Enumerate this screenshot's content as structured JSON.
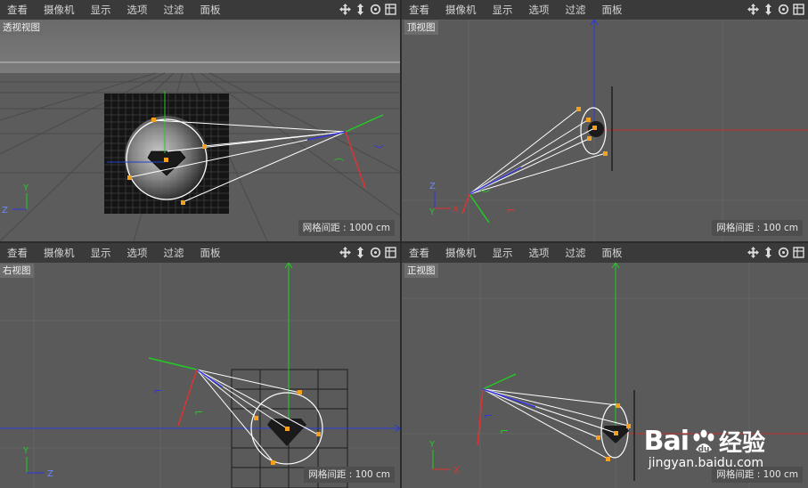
{
  "menu": [
    "查看",
    "摄像机",
    "显示",
    "选项",
    "过滤",
    "面板"
  ],
  "viewports": {
    "perspective": {
      "label": "透视视图",
      "grid_spacing": "网格间距 : 1000 cm"
    },
    "top": {
      "label": "顶视图",
      "grid_spacing": "网格间距 : 100 cm"
    },
    "right": {
      "label": "右视图",
      "grid_spacing": "网格间距 : 100 cm"
    },
    "front": {
      "label": "正视图",
      "grid_spacing": "网格间距 : 100 cm"
    }
  },
  "axis_labels": {
    "x": "X",
    "y": "Y",
    "z": "Z"
  },
  "watermark": {
    "brand": "Bai",
    "brand2": "百度",
    "text": "经验",
    "url": "jingyan.baidu.com"
  },
  "icons": [
    "move-view-icon",
    "zoom-view-icon",
    "rotate-view-icon",
    "toggle-view-icon"
  ],
  "colors": {
    "x_axis": "#d03030",
    "y_axis": "#30c030",
    "z_axis": "#3040d8",
    "handle": "#f5a020",
    "bg": "#5a5a5a",
    "menubar": "#3a3a3a"
  }
}
